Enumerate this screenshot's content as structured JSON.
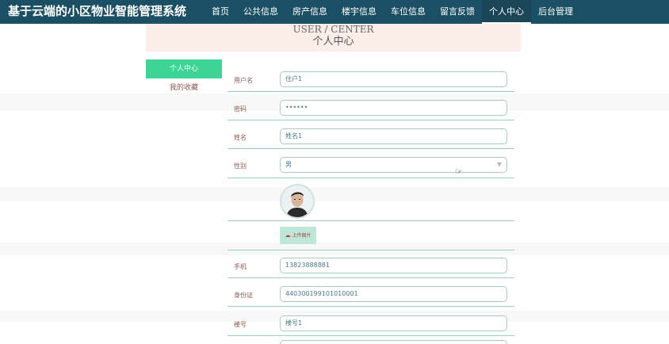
{
  "app": {
    "title": "基于云端的小区物业智能管理系统"
  },
  "nav": {
    "items": [
      {
        "label": "首页",
        "active": false
      },
      {
        "label": "公共信息",
        "active": false
      },
      {
        "label": "房产信息",
        "active": false
      },
      {
        "label": "楼宇信息",
        "active": false
      },
      {
        "label": "车位信息",
        "active": false
      },
      {
        "label": "留言反馈",
        "active": false
      },
      {
        "label": "个人中心",
        "active": true
      },
      {
        "label": "后台管理",
        "active": false
      }
    ]
  },
  "banner": {
    "title_en": "USER / CENTER",
    "title_cn": "个人中心"
  },
  "sidebar": {
    "items": [
      {
        "label": "个人中心",
        "active": true
      },
      {
        "label": "我的收藏",
        "active": false
      }
    ]
  },
  "form": {
    "username": {
      "label": "用户名",
      "value": "住户1"
    },
    "password": {
      "label": "密码",
      "value": "••••••"
    },
    "name": {
      "label": "姓名",
      "value": "姓名1"
    },
    "gender": {
      "label": "性别",
      "value": "男"
    },
    "upload": {
      "label": "上传图片"
    },
    "phone": {
      "label": "手机",
      "value": "13823888881"
    },
    "idcard": {
      "label": "身份证",
      "value": "440300199101010001"
    },
    "building": {
      "label": "楼号",
      "value": "楼号1"
    }
  },
  "icons": {
    "upload": "cloud-upload-icon",
    "dropdown": "chevron-down-icon",
    "cursor": "hand-cursor-icon"
  },
  "colors": {
    "nav_bg": "#1b4f63",
    "accent": "#3dd496",
    "banner_bg": "#fbeee8"
  }
}
